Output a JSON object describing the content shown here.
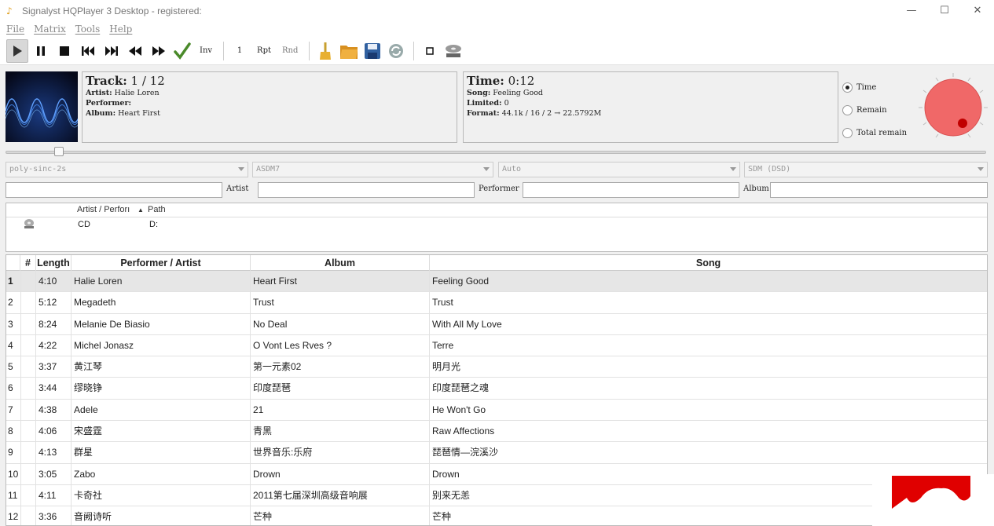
{
  "window": {
    "title": "Signalyst HQPlayer 3 Desktop - registered:",
    "minimize": "—",
    "maximize": "☐",
    "close": "✕"
  },
  "menu": [
    "File",
    "Matrix",
    "Tools",
    "Help"
  ],
  "toolbar": {
    "inv_label": "Inv",
    "one_label": "1",
    "rpt_label": "Rpt",
    "rnd_label": "Rnd"
  },
  "track_info": {
    "track_label": "Track:",
    "track_value": "1 / 12",
    "artist_label": "Artist:",
    "artist_value": "Halie Loren",
    "performer_label": "Performer:",
    "performer_value": "",
    "album_label": "Album:",
    "album_value": "Heart First"
  },
  "time_info": {
    "time_label": "Time:",
    "time_value": "0:12",
    "song_label": "Song:",
    "song_value": "Feeling Good",
    "limited_label": "Limited:",
    "limited_value": "0",
    "format_label": "Format:",
    "format_value": "44.1k / 16 / 2 → 22.5792M"
  },
  "time_mode": {
    "options": [
      "Time",
      "Remain",
      "Total remain"
    ],
    "selected": "Time"
  },
  "seek_position": 0.05,
  "volume_color": "#f06060",
  "combos": {
    "filter": "poly-sinc-2s",
    "modulator": "ASDM7",
    "output": "Auto",
    "mode": "SDM (DSD)"
  },
  "filters": {
    "artist_label": "Artist",
    "performer_label": "Performer",
    "album_label": "Album",
    "artist_value": "",
    "performer_value": "",
    "album_value": ""
  },
  "sources": {
    "col_artist": "Artist / Perforı",
    "col_path": "Path",
    "rows": [
      {
        "artist": "CD",
        "path": "D:"
      }
    ]
  },
  "playlist": {
    "headers": {
      "num": "#",
      "length": "Length",
      "performer": "Performer / Artist",
      "album": "Album",
      "song": "Song"
    },
    "rows": [
      {
        "n": "1",
        "len": "4:10",
        "perf": "Halie Loren",
        "album": "Heart First",
        "song": "Feeling Good"
      },
      {
        "n": "2",
        "len": "5:12",
        "perf": "Megadeth",
        "album": "Trust",
        "song": "Trust"
      },
      {
        "n": "3",
        "len": "8:24",
        "perf": "Melanie De Biasio",
        "album": "No Deal",
        "song": "With All My Love"
      },
      {
        "n": "4",
        "len": "4:22",
        "perf": "Michel Jonasz",
        "album": "O Vont Les Rves ?",
        "song": "Terre"
      },
      {
        "n": "5",
        "len": "3:37",
        "perf": "黄江琴",
        "album": "第一元素02",
        "song": "明月光"
      },
      {
        "n": "6",
        "len": "3:44",
        "perf": "缪晓铮",
        "album": "印度琵琶",
        "song": "印度琵琶之魂"
      },
      {
        "n": "7",
        "len": "4:38",
        "perf": "Adele",
        "album": "21",
        "song": "He Won't Go"
      },
      {
        "n": "8",
        "len": "4:06",
        "perf": "宋盛霆",
        "album": "青黑",
        "song": "Raw Affections"
      },
      {
        "n": "9",
        "len": "4:13",
        "perf": "群星",
        "album": "世界音乐:乐府",
        "song": "琵琶情—浣溪沙"
      },
      {
        "n": "10",
        "len": "3:05",
        "perf": "Zabo",
        "album": "Drown",
        "song": "Drown"
      },
      {
        "n": "11",
        "len": "4:11",
        "perf": "卡奇社",
        "album": "2011第七届深圳高级音响展",
        "song": "别来无恙"
      },
      {
        "n": "12",
        "len": "3:36",
        "perf": "音阙诗听",
        "album": "芒种",
        "song": "芒种"
      }
    ],
    "selected_index": 0
  }
}
